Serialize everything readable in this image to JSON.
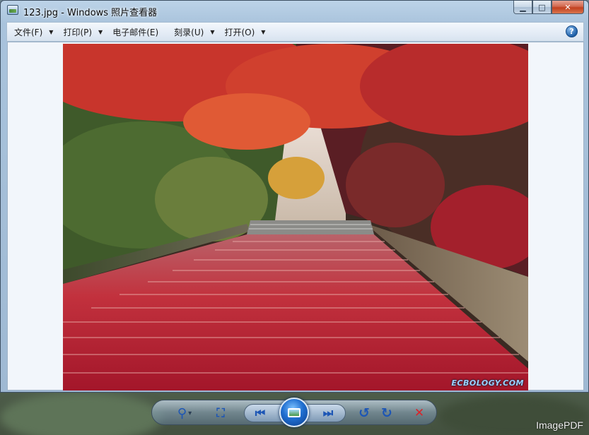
{
  "window": {
    "title": "123.jpg - Windows 照片查看器",
    "minimize_glyph": "▁",
    "maximize_glyph": "□",
    "close_glyph": "✕"
  },
  "menu": {
    "items": [
      {
        "label": "文件(F)",
        "has_dropdown": true
      },
      {
        "label": "打印(P)",
        "has_dropdown": true
      },
      {
        "label": "电子邮件(E)",
        "has_dropdown": false
      },
      {
        "label": "刻录(U)",
        "has_dropdown": true
      },
      {
        "label": "打开(O)",
        "has_dropdown": true
      }
    ],
    "caret_glyph": "▼",
    "help_glyph": "?"
  },
  "photo": {
    "watermark": "ECBOLOGY.COM"
  },
  "toolbar": {
    "icons": [
      "zoom-icon",
      "actual-size-icon",
      "previous-icon",
      "slideshow-icon",
      "next-icon",
      "rotate-counterclockwise-icon",
      "rotate-clockwise-icon",
      "delete-icon"
    ],
    "glyphs": {
      "zoom": "⚲",
      "actual_size": "⛶",
      "previous": "⏮",
      "next": "⏭",
      "rotate_ccw": "↺",
      "rotate_cw": "↻",
      "delete": "✕",
      "zoom_caret": "▾"
    }
  },
  "brand": "ImagePDF",
  "colors": {
    "accent_blue": "#1d56b5",
    "close_red": "#c2401f",
    "delete_red": "#d9242a"
  }
}
